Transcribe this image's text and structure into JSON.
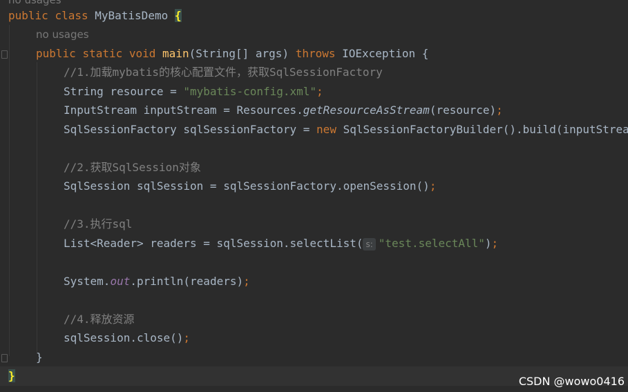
{
  "editor": {
    "top_hint": "no usages",
    "method_hint": "no usages",
    "param_hint": "s:",
    "lines": {
      "class_decl": {
        "kw1": "public",
        "kw2": "class",
        "name": "MyBatisDemo",
        "brace": "{"
      },
      "method_decl": {
        "kw1": "public",
        "kw2": "static",
        "kw3": "void",
        "name": "main",
        "params": "(String[] args) ",
        "throws": "throws",
        "rest": " IOException {"
      },
      "comment1": "//1.加载mybatis的核心配置文件，获取SqlSessionFactory",
      "resource_line": {
        "pre": "String resource = ",
        "str": "\"mybatis-config.xml\"",
        "semi": ";"
      },
      "input_line": {
        "pre": "InputStream inputStream = Resources.",
        "call": "getResourceAsStream",
        "post": "(resource)",
        "semi": ";"
      },
      "factory_line": {
        "pre": "SqlSessionFactory sqlSessionFactory = ",
        "kw": "new",
        "post": " SqlSessionFactoryBuilder().build(inputStream)",
        "semi": ";"
      },
      "comment2": "//2.获取SqlSession对象",
      "session_line": {
        "pre": "SqlSession sqlSession = sqlSessionFactory.openSession()",
        "semi": ";"
      },
      "comment3": "//3.执行sql",
      "select_line": {
        "pre": "List<Reader> readers = sqlSession.selectList(",
        "str": "\"test.selectAll\"",
        "post": ")",
        "semi": ";"
      },
      "print_line": {
        "pre": "System.",
        "field": "out",
        "post": ".println(readers)",
        "semi": ";"
      },
      "comment4": "//4.释放资源",
      "close_line": {
        "pre": "sqlSession.close()",
        "semi": ";"
      },
      "method_close": "}",
      "class_close": "}"
    }
  },
  "watermark": "CSDN @wowo0416",
  "colors": {
    "background": "#2b2b2b",
    "keyword": "#cc7832",
    "function": "#ffc66d",
    "string": "#6a8759",
    "comment": "#808080",
    "text": "#a9b7c6",
    "static_field": "#9876aa",
    "brace_match": "#ffef28"
  }
}
